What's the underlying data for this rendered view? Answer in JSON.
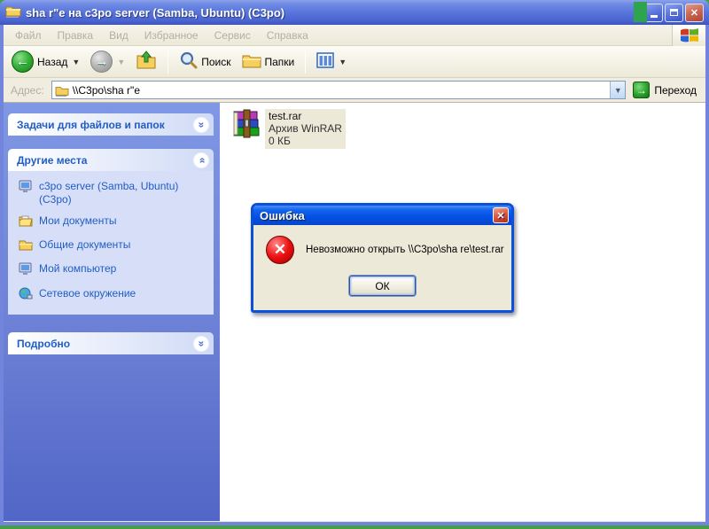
{
  "window": {
    "title": "sha r\"e на c3po server (Samba, Ubuntu) (C3po)"
  },
  "menu": {
    "items": [
      {
        "label": "Файл"
      },
      {
        "label": "Правка"
      },
      {
        "label": "Вид"
      },
      {
        "label": "Избранное"
      },
      {
        "label": "Сервис"
      },
      {
        "label": "Справка"
      }
    ]
  },
  "toolbar": {
    "back_label": "Назад",
    "search_label": "Поиск",
    "folders_label": "Папки"
  },
  "address": {
    "label": "Адрес:",
    "value": "\\\\C3po\\sha r\"e",
    "go_label": "Переход"
  },
  "sidebar": {
    "panels": [
      {
        "title": "Задачи для файлов и папок",
        "collapsed": true
      },
      {
        "title": "Другие места",
        "collapsed": false,
        "items": [
          {
            "label": "c3po server (Samba, Ubuntu) (C3po)",
            "icon": "computer-icon"
          },
          {
            "label": "Мои документы",
            "icon": "my-documents-icon"
          },
          {
            "label": "Общие документы",
            "icon": "shared-documents-icon"
          },
          {
            "label": "Мой компьютер",
            "icon": "my-computer-icon"
          },
          {
            "label": "Сетевое окружение",
            "icon": "network-places-icon"
          }
        ]
      },
      {
        "title": "Подробно",
        "collapsed": true
      }
    ]
  },
  "content": {
    "file": {
      "name": "test.rar",
      "type": "Архив WinRAR",
      "size": "0 КБ"
    }
  },
  "dialog": {
    "title": "Ошибка",
    "message": "Невозможно открыть \\\\C3po\\sha re\\test.rar",
    "ok_label": "ОК"
  },
  "colors": {
    "titlebar_active": "#0a50da",
    "titlebar_inactive": "#5572da",
    "window_border": "#7284dc",
    "desktop_green": "#44a044",
    "taskpane_blue": "#6c80d6",
    "panel_body": "#d6dff7",
    "link_blue": "#215dc6",
    "selection_beige": "#ece9d8",
    "error_red": "#ee1111"
  }
}
